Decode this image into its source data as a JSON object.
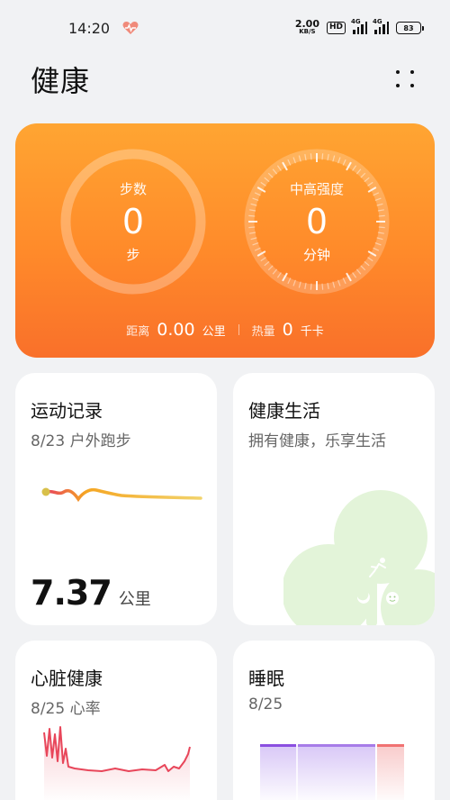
{
  "status_bar": {
    "time": "14:20",
    "net_speed_value": "2.00",
    "net_speed_unit": "KB/S",
    "hd_label": "HD",
    "sim1_label": "4G",
    "sim2_label": "4G",
    "battery": "83"
  },
  "header": {
    "title": "健康"
  },
  "activity": {
    "steps": {
      "label": "步数",
      "value": "0",
      "unit": "步"
    },
    "intensity": {
      "label": "中高强度",
      "value": "0",
      "unit": "分钟"
    },
    "distance": {
      "label": "距离",
      "value": "0.00",
      "unit": "公里"
    },
    "calories": {
      "label": "热量",
      "value": "0",
      "unit": "千卡"
    }
  },
  "cards": {
    "exercise": {
      "title": "运动记录",
      "subtitle": "8/23 户外跑步",
      "metric_value": "7.37",
      "metric_unit": "公里"
    },
    "lifestyle": {
      "title": "健康生活",
      "subtitle": "拥有健康，乐享生活"
    },
    "heart": {
      "title": "心脏健康",
      "subtitle": "8/25 心率"
    },
    "sleep": {
      "title": "睡眠",
      "subtitle": "8/25"
    }
  },
  "colors": {
    "hero_top": "#ffa532",
    "hero_bottom": "#f9702a",
    "heart_line": "#e8465a",
    "sleep_deep": "#8b4fe0",
    "sleep_awake": "#f07272",
    "clover": "#e3f4d9"
  }
}
